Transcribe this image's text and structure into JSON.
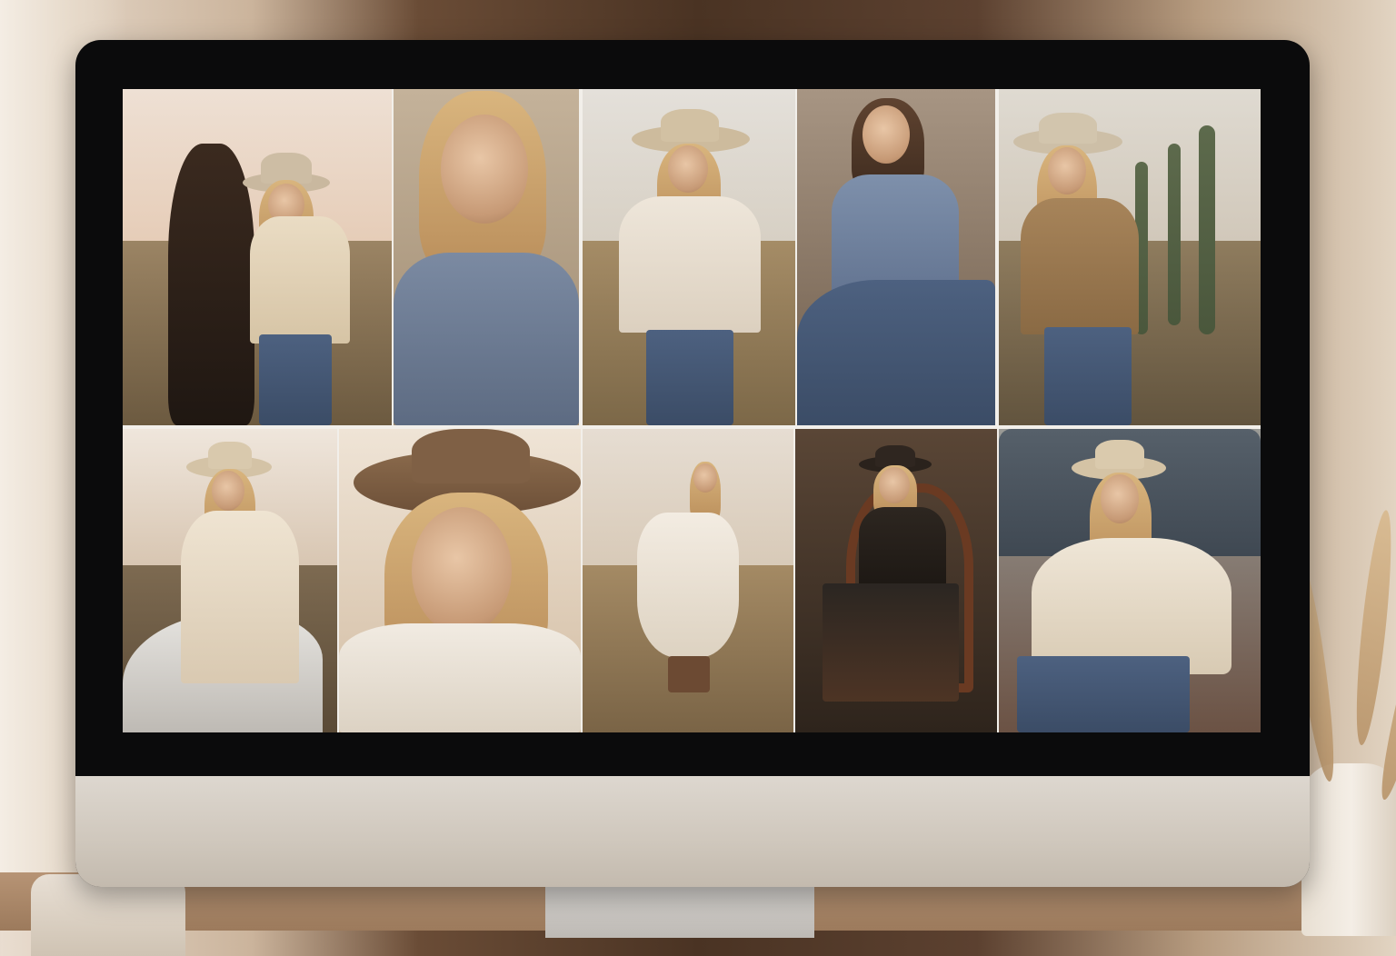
{
  "scene": {
    "description_colors": {
      "wall_left": "#e9ddd0",
      "wall_center": "#4a3323",
      "monitor_bezel": "#0b0b0c",
      "monitor_chin": "#d8d1c8"
    }
  },
  "gallery": {
    "photos": [
      {
        "subject": "woman-with-horse",
        "palette": [
          "#e8d7c7",
          "#8d7a5e"
        ]
      },
      {
        "subject": "blonde-denim-portrait",
        "palette": [
          "#b7a38a",
          "#6f7d92"
        ]
      },
      {
        "subject": "woman-cowboy-hat-lace-top",
        "palette": [
          "#e3ddd3",
          "#9c8662"
        ]
      },
      {
        "subject": "woman-denim-shirt-seated",
        "palette": [
          "#9a8670",
          "#6d7e97"
        ]
      },
      {
        "subject": "woman-suede-jacket-cactus",
        "palette": [
          "#d9d2c6",
          "#8f7b5d"
        ]
      },
      {
        "subject": "woman-riding-white-horse",
        "palette": [
          "#d6c8b8",
          "#7b6a52"
        ]
      },
      {
        "subject": "woman-brown-hat-closeup",
        "palette": [
          "#efe3d3",
          "#b68b62"
        ]
      },
      {
        "subject": "woman-white-dress-field",
        "palette": [
          "#e3dbd0",
          "#a78a63"
        ]
      },
      {
        "subject": "woman-black-hat-chair",
        "palette": [
          "#4d3a2b",
          "#2c221b"
        ]
      },
      {
        "subject": "woman-fur-coat-truck",
        "palette": [
          "#8b8f92",
          "#6d4a36"
        ]
      }
    ]
  }
}
